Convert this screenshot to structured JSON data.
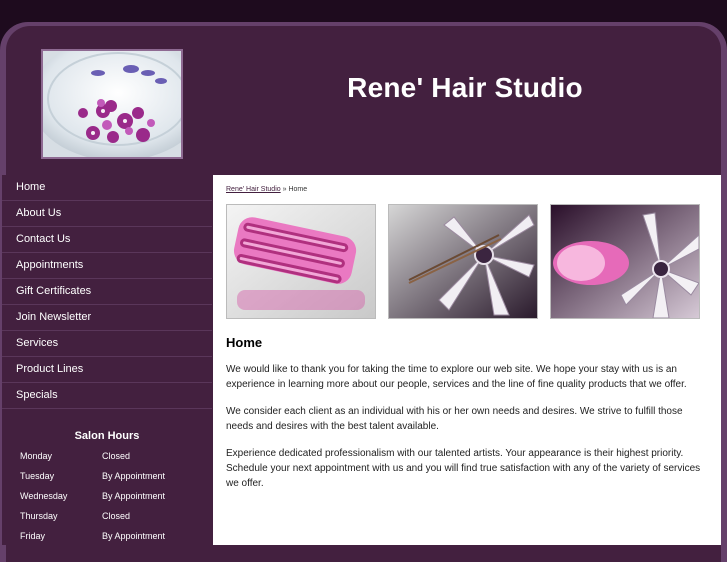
{
  "header": {
    "site_title": "Rene' Hair Studio",
    "logo_icon": "orchid-bowl-icon"
  },
  "nav": {
    "items": [
      {
        "label": "Home"
      },
      {
        "label": "About Us"
      },
      {
        "label": "Contact Us"
      },
      {
        "label": "Appointments"
      },
      {
        "label": "Gift Certificates"
      },
      {
        "label": "Join Newsletter"
      },
      {
        "label": "Services"
      },
      {
        "label": "Product Lines"
      },
      {
        "label": "Specials"
      }
    ]
  },
  "hours": {
    "title": "Salon Hours",
    "rows": [
      {
        "day": "Monday",
        "value": "Closed"
      },
      {
        "day": "Tuesday",
        "value": "By Appointment"
      },
      {
        "day": "Wednesday",
        "value": "By Appointment"
      },
      {
        "day": "Thursday",
        "value": "Closed"
      },
      {
        "day": "Friday",
        "value": "By Appointment"
      }
    ]
  },
  "breadcrumb": {
    "link": "Rene' Hair Studio",
    "separator": "»",
    "current": "Home"
  },
  "content": {
    "heading": "Home",
    "paragraphs": [
      "We would like to thank you for taking the time to explore our web site. We hope your stay with us is an experience in learning more about our people, services and the line of fine quality products that we offer.",
      "We consider each client as an individual with his or her own needs and desires. We strive to fulfill those needs and desires with the best talent available.",
      "Experience dedicated professionalism with our talented artists. Your appearance is their highest priority. Schedule your next appointment with us and you will find true satisfaction with any of the variety of services we offer."
    ]
  },
  "photos": [
    {
      "icon": "pink-hairbrush-icon"
    },
    {
      "icon": "bobby-pin-icon"
    },
    {
      "icon": "pink-hair-roller-icon"
    }
  ],
  "colors": {
    "page_bg": "#1e0b1e",
    "frame": "#65406a",
    "panel": "#43203f",
    "content_bg": "#ffffff"
  }
}
